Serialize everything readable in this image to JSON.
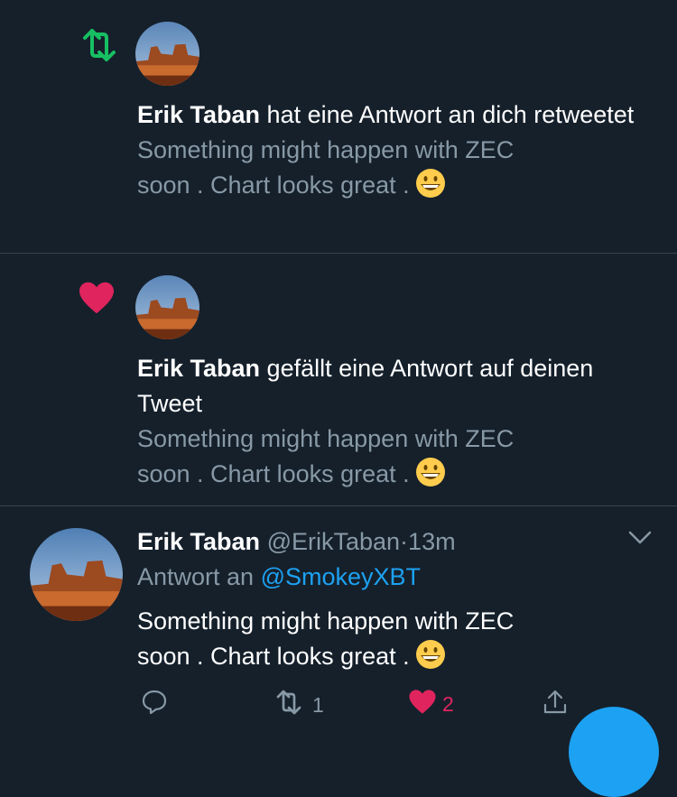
{
  "notifications": [
    {
      "type": "retweet",
      "icon": "retweet-icon",
      "user": "Erik Taban",
      "action": " hat eine Antwort an dich retweetet",
      "preview_line1": "Something might happen with ZEC",
      "preview_line2": "soon .  Chart looks great .",
      "emoji": "😄"
    },
    {
      "type": "like",
      "icon": "heart-icon",
      "user": "Erik Taban",
      "action": " gefällt eine Antwort auf deinen Tweet",
      "preview_line1": "Something might happen with ZEC",
      "preview_line2": "soon .  Chart looks great .",
      "emoji": "😄"
    }
  ],
  "tweet": {
    "name": "Erik Taban",
    "handle": "@ErikTaban",
    "separator": "·",
    "time": "13m",
    "reply_prefix": "Antwort an",
    "reply_to": "@SmokeyXBT",
    "text_line1": "Something might happen with ZEC",
    "text_line2": "soon .  Chart looks great .",
    "emoji": "😄",
    "retweet_count": "1",
    "like_count": "2"
  },
  "colors": {
    "background": "#15202b",
    "retweet_green": "#17bf63",
    "like_red": "#e0245e",
    "link_blue": "#1da1f2",
    "muted": "#8899a6"
  }
}
